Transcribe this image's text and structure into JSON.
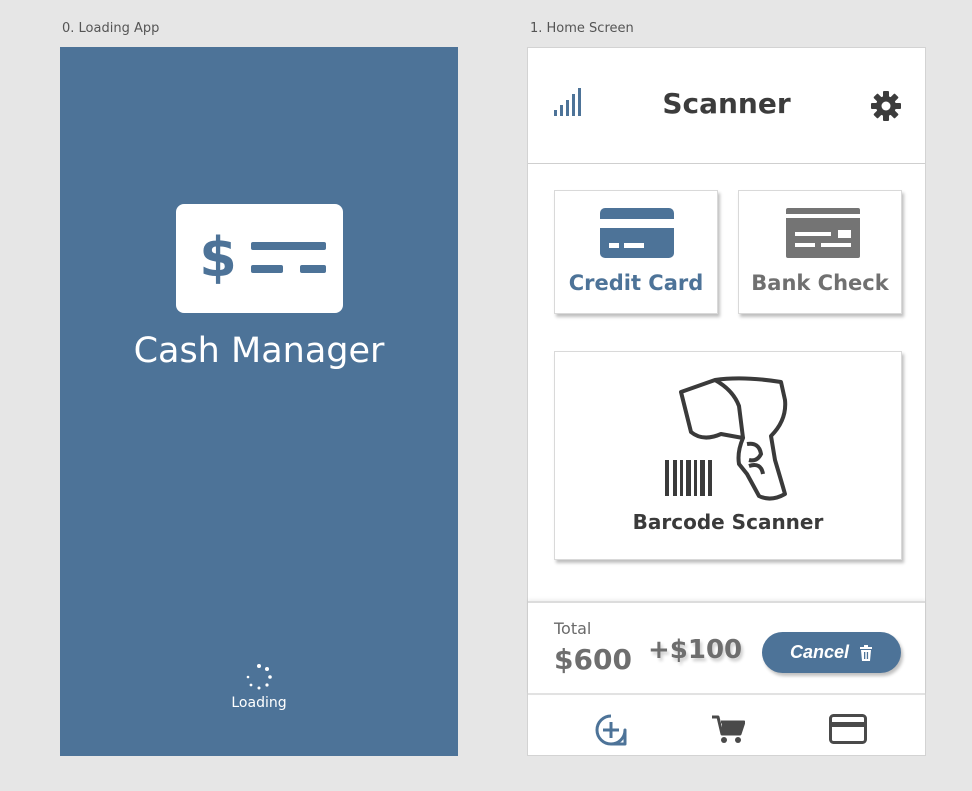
{
  "artboards": {
    "loading_label": "0. Loading App",
    "home_label": "1. Home Screen"
  },
  "loading": {
    "app_title": "Cash Manager",
    "status": "Loading",
    "logo_glyph": "$"
  },
  "home": {
    "title": "Scanner",
    "header_left_icon": "signal-icon",
    "header_right_icon": "gear-icon",
    "tiles": [
      {
        "label": "Credit Card",
        "icon": "credit-card-icon"
      },
      {
        "label": "Bank Check",
        "icon": "bank-check-icon"
      },
      {
        "label": "Barcode Scanner",
        "icon": "barcode-scanner-icon"
      }
    ],
    "total": {
      "label": "Total",
      "value": "$600",
      "delta": "+$100"
    },
    "cancel_label": "Cancel",
    "nav": [
      {
        "icon": "add-icon"
      },
      {
        "icon": "cart-icon"
      },
      {
        "icon": "card-icon"
      }
    ]
  },
  "colors": {
    "brand": "#4d7398",
    "text_dark": "#3c3c3c",
    "text_muted": "#707070",
    "canvas": "#e6e6e6"
  }
}
